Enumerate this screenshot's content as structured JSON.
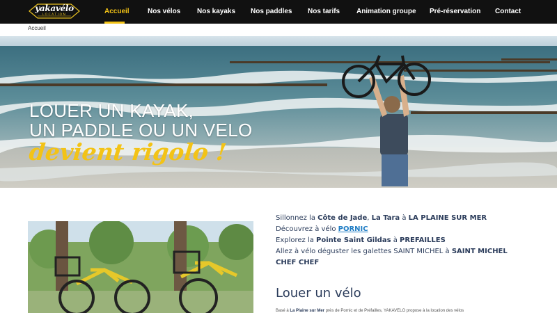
{
  "brand": {
    "logo_text": "yakavélo",
    "logo_sub": "LOCATION",
    "accent_color": "#f3c316",
    "nav_bg": "#111111"
  },
  "nav": {
    "items": [
      "Accueil",
      "Nos vélos",
      "Nos kayaks",
      "Nos paddles",
      "Nos tarifs",
      "Animation groupe",
      "Pré-réservation",
      "Contact"
    ],
    "active_index": 0
  },
  "breadcrumb": "Accueil",
  "hero": {
    "line1": "LOUER UN KAYAK,",
    "line2": "UN PADDLE OU UN VELO",
    "accent": "devient rigolo !"
  },
  "intro": {
    "l1_a": "Sillonnez la ",
    "l1_b": "Côte de Jade",
    "l1_c": ", ",
    "l1_d": "La Tara",
    "l1_e": " à ",
    "l1_f": "LA PLAINE SUR MER",
    "l2_a": "Découvrez à vélo ",
    "l2_link": "PORNIC",
    "l3_a": "Explorez la ",
    "l3_b": "Pointe Saint Gildas",
    "l3_c": " à ",
    "l3_d": "PREFAILLES",
    "l4_a": "Allez à vélo déguster les galettes SAINT MICHEL à ",
    "l4_b": "SAINT MICHEL CHEF CHEF"
  },
  "section": {
    "title": "Louer un vélo",
    "body_a": "Basé à ",
    "body_b": "La Plaine sur Mer",
    "body_c": " près de Pornic et de Préfailles, YAKAVELO propose à la location des vélos"
  },
  "icons": {
    "logo": "yakavelo-logo-icon"
  }
}
